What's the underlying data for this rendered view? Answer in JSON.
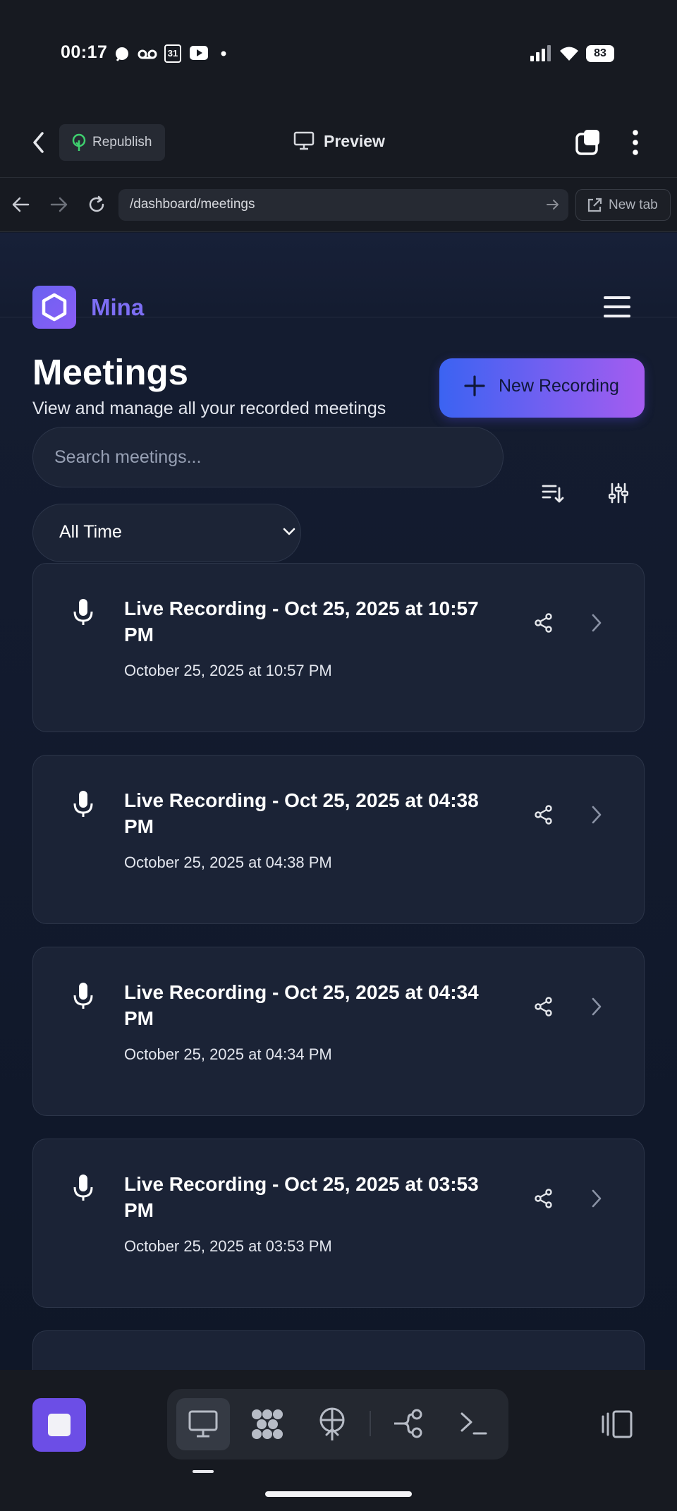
{
  "status_bar": {
    "time": "00:17",
    "calendar_day": "31",
    "battery": "83",
    "icons": [
      "threads-icon",
      "voicemail-icon",
      "calendar-icon",
      "youtube-icon",
      "dot-icon",
      "signal-icon",
      "wifi-icon",
      "battery-icon"
    ]
  },
  "browser": {
    "back_icon": "chevron-left-icon",
    "republish_label": "Republish",
    "preview_label": "Preview",
    "url": "/dashboard/meetings",
    "new_tab_label": "New tab"
  },
  "app": {
    "brand": "Mina",
    "page_title": "Meetings",
    "page_subtitle": "View and manage all your recorded meetings",
    "new_recording_label": "New Recording",
    "search_placeholder": "Search meetings...",
    "time_filter": "All Time"
  },
  "meetings": [
    {
      "title": "Live Recording - Oct 25, 2025 at 10:57 PM",
      "date": "October 25, 2025 at 10:57 PM"
    },
    {
      "title": "Live Recording - Oct 25, 2025 at 04:38 PM",
      "date": "October 25, 2025 at 04:38 PM"
    },
    {
      "title": "Live Recording - Oct 25, 2025 at 04:34 PM",
      "date": "October 25, 2025 at 04:34 PM"
    },
    {
      "title": "Live Recording - Oct 25, 2025 at 03:53 PM",
      "date": "October 25, 2025 at 03:53 PM"
    }
  ],
  "colors": {
    "accent": "#7d6ef4",
    "button_gradient_start": "#3b63f2",
    "button_gradient_end": "#a55cf0",
    "card_bg": "#1b2336",
    "stop_button": "#6c4ee6"
  },
  "bottom_toolbar": {
    "tools": [
      "desktop-preview-icon",
      "apps-grid-icon",
      "deploy-icon",
      "git-branch-icon",
      "terminal-icon"
    ],
    "active_tool": "desktop-preview-icon"
  }
}
